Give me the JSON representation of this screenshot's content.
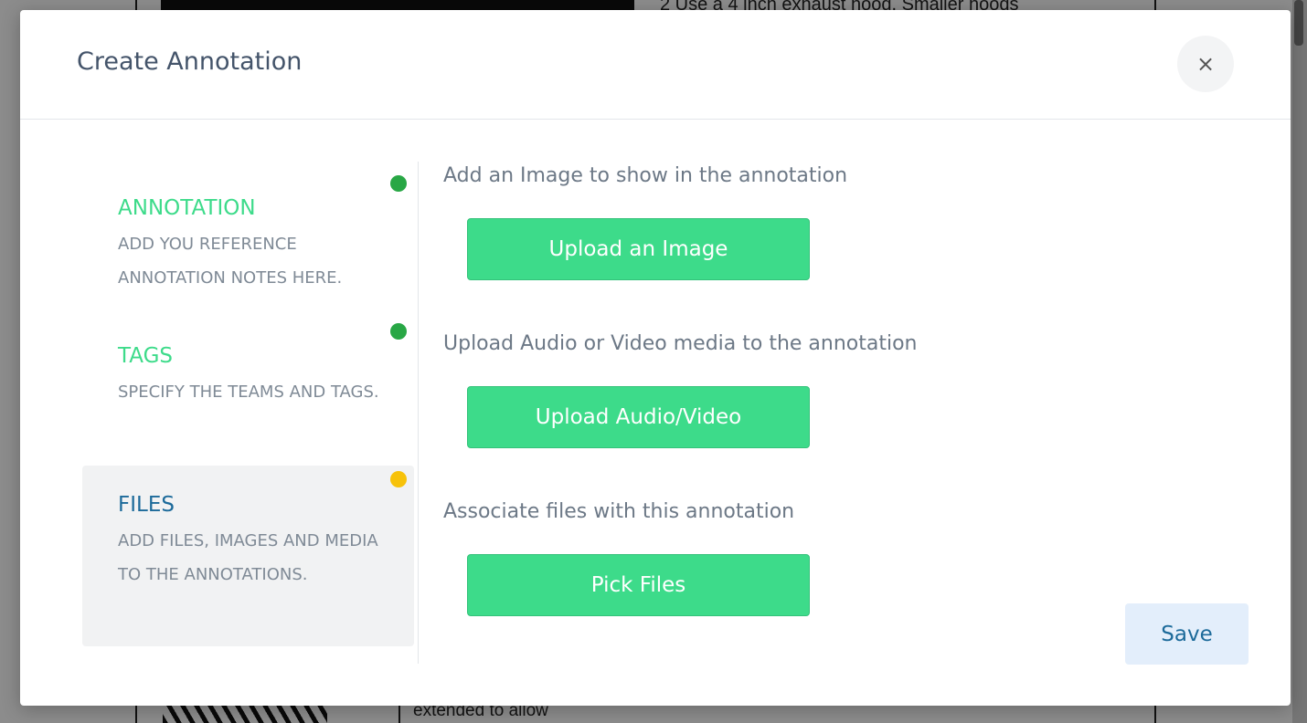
{
  "background": {
    "top_text": "2  Use a 4 inch exhaust hood. Smaller hoods",
    "bottom_text": "extended to allow"
  },
  "modal": {
    "title": "Create Annotation",
    "close_label": "×"
  },
  "steps": [
    {
      "title": "ANNOTATION",
      "description": "ADD YOU REFERENCE ANNOTATION NOTES HERE.",
      "status": "complete",
      "title_color": "#3ddb8a",
      "dot_color": "#28a745"
    },
    {
      "title": "TAGS",
      "description": "SPECIFY THE TEAMS AND TAGS.",
      "status": "complete",
      "title_color": "#3ddb8a",
      "dot_color": "#28a745"
    },
    {
      "title": "FILES",
      "description": "ADD FILES, IMAGES AND MEDIA TO THE ANNOTATIONS.",
      "status": "in-progress",
      "title_color": "#1c6a9a",
      "dot_color": "#f7c20a"
    }
  ],
  "content": {
    "image_label": "Add an Image to show in the annotation",
    "image_button": "Upload an Image",
    "media_label": "Upload Audio or Video media to the annotation",
    "media_button": "Upload Audio/Video",
    "files_label": "Associate files with this annotation",
    "files_button": "Pick Files"
  },
  "footer": {
    "save_label": "Save"
  },
  "colors": {
    "accent_green": "#3ddb8a",
    "status_green": "#28a745",
    "status_yellow": "#f7c20a",
    "active_blue": "#1c6a9a",
    "save_bg": "#e3eefb"
  }
}
